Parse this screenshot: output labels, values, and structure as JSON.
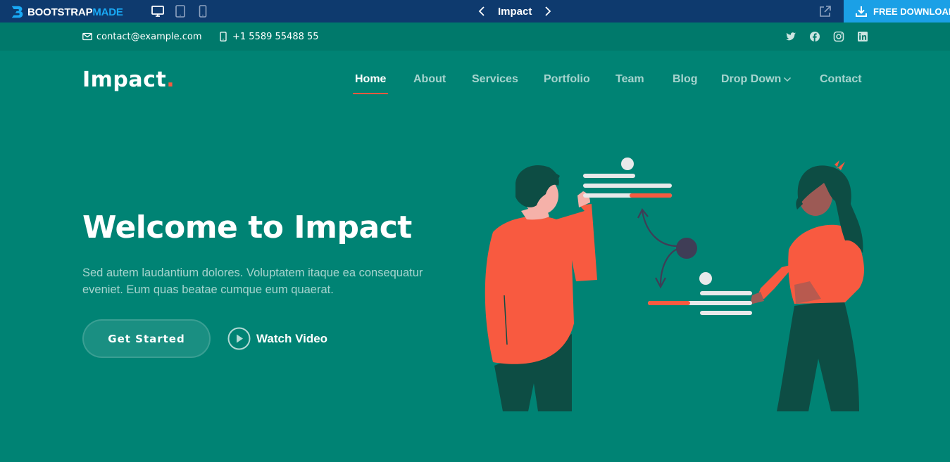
{
  "preview_bar": {
    "brand_main": "BOOTSTRAP",
    "brand_accent": "MADE",
    "title": "Impact",
    "download_label": "FREE DOWNLOAD",
    "devices": [
      "desktop-icon",
      "tablet-icon",
      "mobile-icon"
    ],
    "bg_color": "#0e3a6e",
    "download_color": "#1ba0e6"
  },
  "topbar": {
    "email": "contact@example.com",
    "phone": "+1 5589 55488 55",
    "social": [
      "twitter-icon",
      "facebook-icon",
      "instagram-icon",
      "linkedin-icon"
    ],
    "bg_color": "#00796b"
  },
  "header": {
    "logo_text": "Impact",
    "logo_dot": ".",
    "nav": [
      {
        "label": "Home",
        "active": true
      },
      {
        "label": "About"
      },
      {
        "label": "Services"
      },
      {
        "label": "Portfolio"
      },
      {
        "label": "Team"
      },
      {
        "label": "Blog"
      },
      {
        "label": "Drop Down",
        "dropdown": true
      },
      {
        "label": "Contact"
      }
    ]
  },
  "hero": {
    "title": "Welcome to Impact",
    "text": "Sed autem laudantium dolores. Voluptatem itaque ea consequatur eveniet. Eum quas beatae cumque eum quaerat.",
    "primary_button": "Get Started",
    "video_button": "Watch Video",
    "bg_color": "#008374",
    "accent_color": "#f85a40"
  }
}
